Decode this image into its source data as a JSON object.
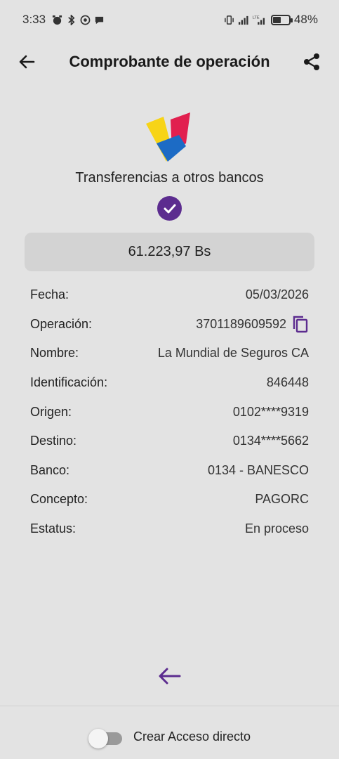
{
  "status_bar": {
    "time": "3:33",
    "battery_percent": "48%",
    "network": "LTE"
  },
  "header": {
    "title": "Comprobante de operación",
    "back_icon": "arrow-left-icon",
    "share_icon": "share-icon"
  },
  "receipt": {
    "subtitle": "Transferencias a otros bancos",
    "amount": "61.223,97 Bs",
    "rows": [
      {
        "label": "Fecha:",
        "value": "05/03/2026"
      },
      {
        "label": "Operación:",
        "value": "3701189609592"
      },
      {
        "label": "Nombre:",
        "value": "La Mundial de Seguros CA"
      },
      {
        "label": "Identificación:",
        "value": "846448"
      },
      {
        "label": "Origen:",
        "value": "0102****9319"
      },
      {
        "label": "Destino:",
        "value": "0134****5662"
      },
      {
        "label": "Banco:",
        "value": "0134 - BANESCO"
      },
      {
        "label": "Concepto:",
        "value": "PAGORC"
      },
      {
        "label": "Estatus:",
        "value": "En proceso"
      }
    ]
  },
  "footer": {
    "shortcut_label": "Crear Acceso directo",
    "shortcut_enabled": false
  },
  "colors": {
    "background": "#e3e3e3",
    "accent": "#5c2c8f",
    "amount_box": "#d3d3d3"
  }
}
